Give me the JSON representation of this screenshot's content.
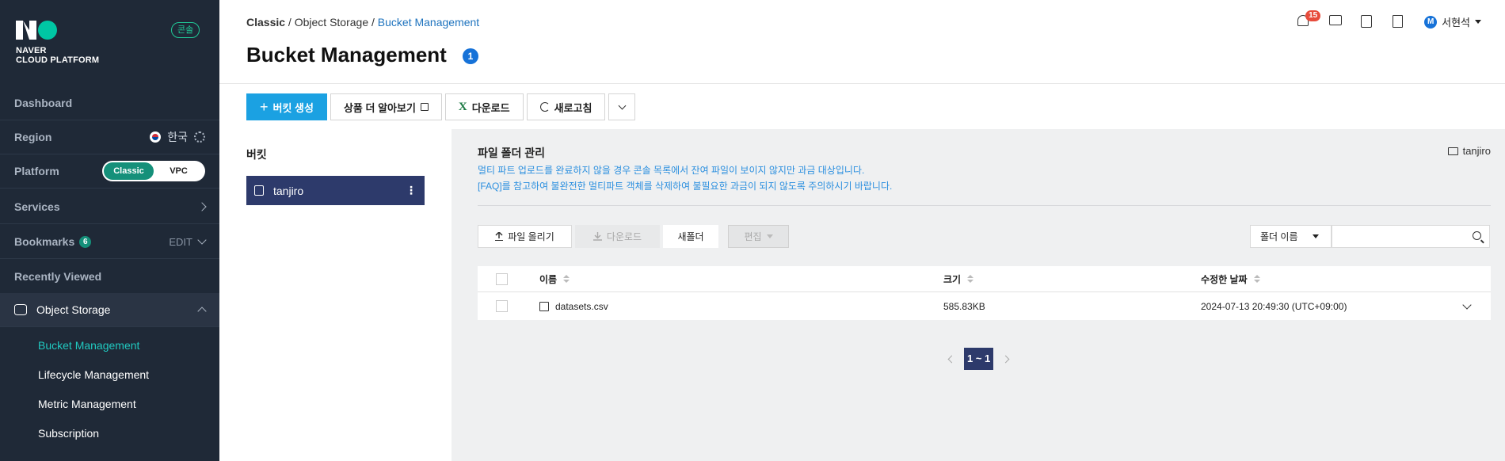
{
  "sidebar": {
    "logo_line1": "NAVER",
    "logo_line2": "CLOUD PLATFORM",
    "console_badge": "콘솔",
    "dashboard": "Dashboard",
    "region_label": "Region",
    "region_value": "한국",
    "platform_label": "Platform",
    "platform_options": [
      "Classic",
      "VPC"
    ],
    "platform_selected": "Classic",
    "services": "Services",
    "bookmarks": "Bookmarks",
    "bookmarks_count": "6",
    "bookmarks_edit": "EDIT",
    "recently_viewed": "Recently Viewed",
    "object_storage": "Object Storage",
    "sub_items": [
      "Bucket Management",
      "Lifecycle Management",
      "Metric Management",
      "Subscription"
    ],
    "active_sub_item": "Bucket Management"
  },
  "header": {
    "breadcrumb": [
      "Classic",
      "Object Storage",
      "Bucket Management"
    ],
    "title": "Bucket Management",
    "title_badge": "1",
    "notif_count": "15",
    "user_initial": "M",
    "user_name": "서현석"
  },
  "toolbar": {
    "create_bucket": "버킷 생성",
    "learn_more": "상품 더 알아보기",
    "download": "다운로드",
    "refresh": "새로고침"
  },
  "bucket_panel": {
    "title": "버킷",
    "buckets": [
      "tanjiro"
    ]
  },
  "main": {
    "title": "파일 폴더 관리",
    "note1": "멀티 파트 업로드를 완료하지 않을 경우 콘솔 목록에서 잔여 파일이 보이지 않지만 과금 대상입니다.",
    "note2": "[FAQ]를 참고하여 불완전한 멀티파트 객체를 삭제하여 불필요한 과금이 되지 않도록 주의하시기 바랍니다.",
    "current_folder": "tanjiro",
    "upload": "파일 올리기",
    "download": "다운로드",
    "new_folder": "새폴더",
    "edit": "편집",
    "search_select": "폴더 이름",
    "search_placeholder": "",
    "columns": [
      "이름",
      "크기",
      "수정한 날짜"
    ],
    "rows": [
      {
        "name": "datasets.csv",
        "size": "585.83KB",
        "date": "2024-07-13 20:49:30 (UTC+09:00)"
      }
    ],
    "pager": "1 ~ 1"
  },
  "colors": {
    "sidebar_bg": "#1f2937",
    "accent_teal": "#20c9c0",
    "primary_blue": "#1ba1e2",
    "bucket_active": "#2d3a6b"
  }
}
